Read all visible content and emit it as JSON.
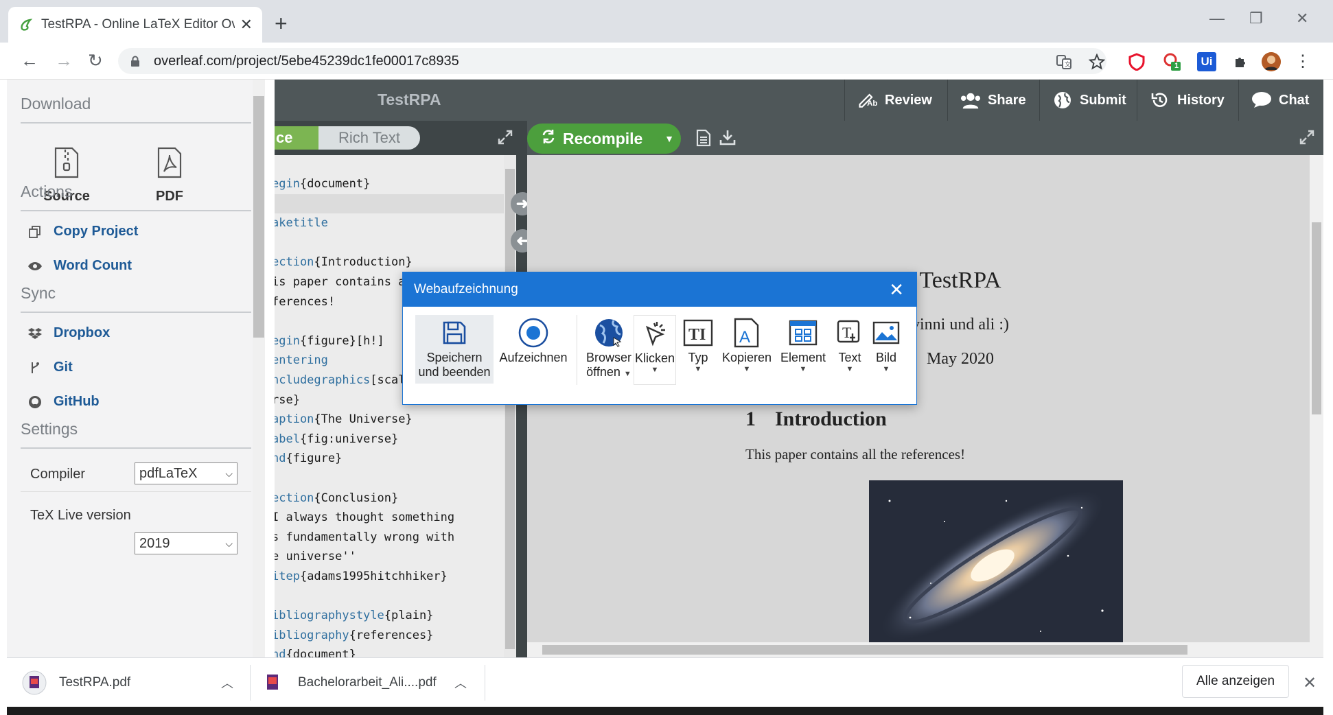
{
  "browser": {
    "tab_title": "TestRPA - Online LaTeX Editor Ov",
    "url": "overleaf.com/project/5ebe45239dc1fe00017c8935",
    "extension_badge": "1",
    "ui_ext_label": "Ui"
  },
  "left_panel": {
    "download_heading": "Download",
    "download_items": [
      {
        "label": "Source"
      },
      {
        "label": "PDF"
      }
    ],
    "actions_heading": "Actions",
    "actions": [
      {
        "label": "Copy Project"
      },
      {
        "label": "Word Count"
      }
    ],
    "sync_heading": "Sync",
    "sync_items": [
      {
        "label": "Dropbox"
      },
      {
        "label": "Git"
      },
      {
        "label": "GitHub"
      }
    ],
    "settings_heading": "Settings",
    "compiler_label": "Compiler",
    "compiler_value": "pdfLaTeX",
    "texlive_label": "TeX Live version",
    "texlive_value": "2019"
  },
  "overleaf_header": {
    "project_title": "TestRPA",
    "buttons": [
      {
        "label": "Review"
      },
      {
        "label": "Share"
      },
      {
        "label": "Submit"
      },
      {
        "label": "History"
      },
      {
        "label": "Chat"
      }
    ]
  },
  "editor_toolbar": {
    "source_toggle": "ce",
    "rich_text_toggle": "Rich Text",
    "recompile_label": "Recompile"
  },
  "code_lines": [
    {
      "cmd": "egin",
      "arg": "{document}",
      "hl": false
    },
    {
      "cmd": "",
      "arg": "",
      "hl": true
    },
    {
      "cmd": "aketitle",
      "arg": "",
      "hl": false
    },
    {
      "cmd": "",
      "arg": "",
      "hl": false
    },
    {
      "cmd": "ection",
      "arg": "{Introduction}",
      "hl": false
    },
    {
      "cmd": "",
      "arg": "is paper contains all the",
      "hl": false
    },
    {
      "cmd": "",
      "arg": "ferences!",
      "hl": false
    },
    {
      "cmd": "",
      "arg": "",
      "hl": false
    },
    {
      "cmd": "egin",
      "arg": "{figure}[h!]",
      "hl": false
    },
    {
      "cmd": "entering",
      "arg": "",
      "hl": false
    },
    {
      "cmd": "ncludegraphics",
      "arg": "[scale=1.7]{unive",
      "hl": false
    },
    {
      "cmd": "",
      "arg": "rse}",
      "hl": false
    },
    {
      "cmd": "aption",
      "arg": "{The Universe}",
      "hl": false
    },
    {
      "cmd": "abel",
      "arg": "{fig:universe}",
      "hl": false
    },
    {
      "cmd": "nd",
      "arg": "{figure}",
      "hl": false
    },
    {
      "cmd": "",
      "arg": "",
      "hl": false
    },
    {
      "cmd": "ection",
      "arg": "{Conclusion}",
      "hl": false
    },
    {
      "cmd": "",
      "arg": "I always thought something",
      "hl": false
    },
    {
      "cmd": "",
      "arg": "s fundamentally wrong with",
      "hl": false
    },
    {
      "cmd": "",
      "arg": "e universe''",
      "hl": false
    },
    {
      "cmd": "itep",
      "arg": "{adams1995hitchhiker}",
      "hl": false
    },
    {
      "cmd": "",
      "arg": "",
      "hl": false
    },
    {
      "cmd": "ibliographystyle",
      "arg": "{plain}",
      "hl": false
    },
    {
      "cmd": "ibliography",
      "arg": "{references}",
      "hl": false
    },
    {
      "cmd": "nd",
      "arg": "{document}",
      "hl": false
    }
  ],
  "pdf": {
    "title": "TestRPA",
    "authors": "vinni und ali :)",
    "date": "May 2020",
    "section_number": "1",
    "section_title": "Introduction",
    "body_text": "This paper contains all the references!"
  },
  "recorder_dialog": {
    "title": "Webaufzeichnung",
    "tools": [
      {
        "line1": "Speichern",
        "line2": "und beenden"
      },
      {
        "line1": "Aufzeichnen",
        "line2": ""
      },
      {
        "line1": "Browser",
        "line2": "öffnen"
      },
      {
        "line1": "Klicken",
        "line2": ""
      },
      {
        "line1": "Typ",
        "line2": ""
      },
      {
        "line1": "Kopieren",
        "line2": ""
      },
      {
        "line1": "Element",
        "line2": ""
      },
      {
        "line1": "Text",
        "line2": ""
      },
      {
        "line1": "Bild",
        "line2": ""
      }
    ]
  },
  "downloads": {
    "items": [
      {
        "name": "TestRPA.pdf"
      },
      {
        "name": "Bachelorarbeit_Ali....pdf"
      }
    ],
    "show_all": "Alle anzeigen"
  },
  "colors": {
    "overleaf_green": "#4c9f3d",
    "overleaf_dark": "#4f5759",
    "link_blue": "#1e5a96",
    "dialog_blue": "#1b74d4"
  }
}
